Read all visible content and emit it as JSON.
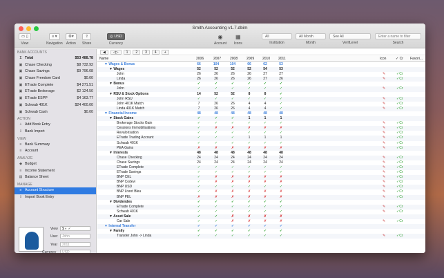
{
  "window": {
    "title": "Smith Accounting v1.7.dbim"
  },
  "toolbar": {
    "view_label": "View",
    "navigation_label": "Navigation",
    "action_label": "Action",
    "share_label": "Share",
    "currency_value": "USD",
    "currency_label": "Currency",
    "account_label": "Account",
    "icons_label": "Icons",
    "institution_value": "All",
    "institution_label": "Institution",
    "month_value": "All Month",
    "month_label": "Month",
    "verif_value": "See All",
    "verif_label": "VerifLevel",
    "search_placeholder": "Enter a name to filter",
    "search_label": "Search"
  },
  "sidebar": {
    "bank_header": "BANK ACCOUNTS",
    "accounts": [
      {
        "name": "Total",
        "amount": "$53 488.78"
      },
      {
        "name": "Chase Checking",
        "amount": "$8 732.92"
      },
      {
        "name": "Chase Savings",
        "amount": "$9 796.08"
      },
      {
        "name": "Chase Freedom Card",
        "amount": "$0.00"
      },
      {
        "name": "ETrade Complete",
        "amount": "$4 271.51"
      },
      {
        "name": "ETrade Brokerage",
        "amount": "$2 124.50"
      },
      {
        "name": "ETrade ESPP",
        "amount": "$4 163.77"
      },
      {
        "name": "Schwab 401K",
        "amount": "$24 400.00"
      },
      {
        "name": "Schwab Cash",
        "amount": "$0.00"
      }
    ],
    "action_header": "ACTION",
    "actions": [
      "Add Book Entry",
      "Bank Import"
    ],
    "view_header": "VIEW",
    "views": [
      "Bank Summary",
      "Account"
    ],
    "analyze_header": "ANALYZE",
    "analyze": [
      "Budget",
      "Income Statement",
      "Balance Sheet"
    ],
    "manage_header": "MANAGE",
    "manage": [
      "Account Structure",
      "Import Book Entry"
    ]
  },
  "bottom": {
    "view_label": "View",
    "user_label": "User",
    "user_value": "John",
    "year_label": "Year",
    "year_value": "2011",
    "currency_label": "Currency",
    "currency_value": "USD"
  },
  "nav_tabs": [
    "1",
    "2",
    "3",
    "4"
  ],
  "columns": {
    "name": "Name",
    "years": [
      "2006",
      "2007",
      "2008",
      "2009",
      "2010",
      "2011"
    ],
    "icon": "Icon",
    "cr": "Cr",
    "favorite": "Favori..."
  },
  "rows": [
    {
      "t": "sec",
      "d": 0,
      "n": "Wages & Bonus",
      "v": [
        "66",
        "104",
        "104",
        "66",
        "62",
        "53"
      ],
      "ic": "",
      "cr": ""
    },
    {
      "t": "grp",
      "d": 1,
      "n": "Wages",
      "v": [
        "52",
        "52",
        "52",
        "52",
        "54",
        "53"
      ],
      "ic": "",
      "cr": ""
    },
    {
      "t": "leaf",
      "d": 2,
      "n": "John",
      "v": [
        "26",
        "26",
        "26",
        "26",
        "27",
        "27"
      ],
      "ic": "✎",
      "cr": "✓Cr"
    },
    {
      "t": "leaf",
      "d": 2,
      "n": "Linda",
      "v": [
        "26",
        "26",
        "26",
        "26",
        "27",
        "26"
      ],
      "ic": "✎",
      "cr": "✓Cr"
    },
    {
      "t": "grp",
      "d": 1,
      "n": "Bonus",
      "v": [
        "✓",
        "✓",
        "✓",
        "✓",
        "✓",
        "✓"
      ],
      "ic": "",
      "cr": ""
    },
    {
      "t": "leaf",
      "d": 2,
      "n": "John",
      "v": [
        "✓",
        "✓",
        "✓",
        "✓",
        "✓",
        "✓"
      ],
      "ic": "✎",
      "cr": "✓Cr"
    },
    {
      "t": "grp",
      "d": 1,
      "n": "RSU & Stock Options",
      "v": [
        "14",
        "52",
        "52",
        "8",
        "8",
        "✓"
      ],
      "ic": "",
      "cr": ""
    },
    {
      "t": "leaf",
      "d": 2,
      "n": "John RSU",
      "v": [
        "✓",
        "✓",
        "✓",
        "✓",
        "✓",
        "✓"
      ],
      "ic": "✎",
      "cr": "✓Cr"
    },
    {
      "t": "leaf",
      "d": 2,
      "n": "John 401K Match",
      "v": [
        "7",
        "26",
        "26",
        "4",
        "4",
        "✓"
      ],
      "ic": "✎",
      "cr": "✓Cr"
    },
    {
      "t": "leaf",
      "d": 2,
      "n": "Linda 401K Match",
      "v": [
        "7",
        "26",
        "26",
        "4",
        "4",
        "✓"
      ],
      "ic": "✎",
      "cr": "✓Cr"
    },
    {
      "t": "sec",
      "d": 0,
      "n": "Financial Income",
      "v": [
        "48",
        "48",
        "48",
        "48",
        "48",
        "48"
      ],
      "ic": "",
      "cr": ""
    },
    {
      "t": "grp",
      "d": 1,
      "n": "Stock Gains",
      "v": [
        "✓",
        "✓",
        "✓",
        "1",
        "1",
        "1"
      ],
      "ic": "",
      "cr": ""
    },
    {
      "t": "leaf",
      "d": 2,
      "n": "Brokerage Stocks Gain",
      "v": [
        "✓",
        "✓",
        "✓",
        "✓",
        "✓",
        "✓"
      ],
      "ic": "✎",
      "cr": "✓Cr"
    },
    {
      "t": "leaf",
      "d": 2,
      "n": "Cessions Immobilisations",
      "v": [
        "✓",
        "✗",
        "✗",
        "✗",
        "✗",
        "✗"
      ],
      "ic": "✎",
      "cr": "✓Cr"
    },
    {
      "t": "leaf",
      "d": 2,
      "n": "Revalorisation",
      "v": [
        "✓",
        "✓",
        "✓",
        "✓",
        "✓",
        "✓"
      ],
      "ic": "✎",
      "cr": "✓Cr"
    },
    {
      "t": "leaf",
      "d": 2,
      "n": "ETrade Trading Account",
      "v": [
        "✓",
        "✓",
        "✓",
        "1",
        "1",
        "1"
      ],
      "ic": "✎",
      "cr": "✓Cr"
    },
    {
      "t": "leaf",
      "d": 2,
      "n": "Schwab 401K",
      "v": [
        "✓",
        "✓",
        "✓",
        "✓",
        "✓",
        "✓"
      ],
      "ic": "✎",
      "cr": "✓Cr"
    },
    {
      "t": "leaf",
      "d": 2,
      "n": "PEA Gains",
      "v": [
        "✗",
        "✗",
        "✗",
        "✗",
        "✗",
        "✗"
      ],
      "ic": "✎",
      "cr": "✓Cr"
    },
    {
      "t": "grp",
      "d": 1,
      "n": "Interests",
      "v": [
        "48",
        "48",
        "48",
        "48",
        "48",
        "48"
      ],
      "ic": "",
      "cr": ""
    },
    {
      "t": "leaf",
      "d": 2,
      "n": "Chase Checking",
      "v": [
        "24",
        "24",
        "24",
        "24",
        "24",
        "24"
      ],
      "ic": "✎",
      "cr": "✓Cr"
    },
    {
      "t": "leaf",
      "d": 2,
      "n": "Chase Savings",
      "v": [
        "24",
        "24",
        "24",
        "24",
        "24",
        "24"
      ],
      "ic": "✎",
      "cr": "✓Cr"
    },
    {
      "t": "leaf",
      "d": 2,
      "n": "ETrade Complete",
      "v": [
        "✓",
        "✓",
        "✓",
        "✓",
        "✓",
        "✓"
      ],
      "ic": "✎",
      "cr": "✓Cr"
    },
    {
      "t": "leaf",
      "d": 2,
      "n": "ETrade Savings",
      "v": [
        "✓",
        "✓",
        "✓",
        "✓",
        "✓",
        "✓"
      ],
      "ic": "✎",
      "cr": "✓Cr"
    },
    {
      "t": "leaf",
      "d": 2,
      "n": "BNP CEL",
      "v": [
        "✓",
        "✗",
        "✗",
        "✗",
        "✗",
        "✗"
      ],
      "ic": "✎",
      "cr": "✓Cr"
    },
    {
      "t": "leaf",
      "d": 2,
      "n": "BNP Codevi",
      "v": [
        "✓",
        "✗",
        "✗",
        "✗",
        "✗",
        "✗"
      ],
      "ic": "✎",
      "cr": "✓Cr"
    },
    {
      "t": "leaf",
      "d": 2,
      "n": "BNP USD",
      "v": [
        "✓",
        "✓",
        "✓",
        "✓",
        "✓",
        "✓"
      ],
      "ic": "✎",
      "cr": "✓Cr"
    },
    {
      "t": "leaf",
      "d": 2,
      "n": "BNP Livret Bleu",
      "v": [
        "✓",
        "✗",
        "✗",
        "✗",
        "✗",
        "✗"
      ],
      "ic": "✎",
      "cr": "✓Cr"
    },
    {
      "t": "leaf",
      "d": 2,
      "n": "BNP PEL",
      "v": [
        "✗",
        "✗",
        "✗",
        "✗",
        "✗",
        "✗"
      ],
      "ic": "✎",
      "cr": "✓Cr"
    },
    {
      "t": "grp",
      "d": 1,
      "n": "Dividendes",
      "v": [
        "✓",
        "✓",
        "✓",
        "✓",
        "✓",
        "✓"
      ],
      "ic": "",
      "cr": ""
    },
    {
      "t": "leaf",
      "d": 2,
      "n": "ETrade Complete",
      "v": [
        "✓",
        "✓",
        "✓",
        "✓",
        "✓",
        "✓"
      ],
      "ic": "✎",
      "cr": "✓Cr"
    },
    {
      "t": "leaf",
      "d": 2,
      "n": "Schwab 401K",
      "v": [
        "✓",
        "✓",
        "✓",
        "✓",
        "✓",
        "✓"
      ],
      "ic": "✎",
      "cr": "✓Cr"
    },
    {
      "t": "grp",
      "d": 1,
      "n": "Asset Sale",
      "v": [
        "✓",
        "✓",
        "✗",
        "✗",
        "✗",
        "✗"
      ],
      "ic": "",
      "cr": ""
    },
    {
      "t": "leaf",
      "d": 2,
      "n": "Car Sale",
      "v": [
        "✓",
        "✓",
        "✗",
        "✗",
        "✗",
        "✗"
      ],
      "ic": "✎",
      "cr": "✓Cr"
    },
    {
      "t": "sec",
      "d": 0,
      "n": "Internal Transfer",
      "v": [
        "✓",
        "✓",
        "✓",
        "✓",
        "✓",
        "✓"
      ],
      "ic": "",
      "cr": ""
    },
    {
      "t": "grp",
      "d": 1,
      "n": "Family",
      "v": [
        "✓",
        "✓",
        "✓",
        "✓",
        "✓",
        "✓"
      ],
      "ic": "",
      "cr": ""
    },
    {
      "t": "leaf",
      "d": 2,
      "n": "Transfer John -> Linda",
      "v": [
        "✓",
        "✓",
        "✓",
        "✓",
        "✓",
        "✓"
      ],
      "ic": "✎",
      "cr": "✓Cr"
    }
  ]
}
